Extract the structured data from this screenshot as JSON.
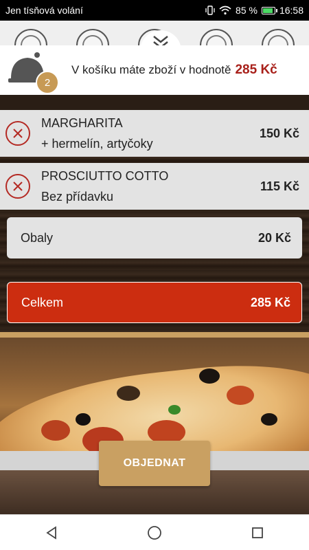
{
  "status_bar": {
    "carrier": "Jen tísňová volání",
    "battery_percent": "85 %",
    "battery_level": 0.85,
    "time": "16:58",
    "icons": [
      "vibrate-icon",
      "wifi-icon",
      "battery-icon"
    ]
  },
  "cart": {
    "item_count": "2",
    "message": "V košíku máte zboží v hodnotě",
    "total": "285 Kč"
  },
  "items": [
    {
      "name": "MARGHARITA",
      "extras": "+ hermelín, artyčoky",
      "price": "150 Kč"
    },
    {
      "name": "PROSCIUTTO COTTO",
      "extras": "Bez přídavku",
      "price": "115 Kč"
    }
  ],
  "packaging": {
    "label": "Obaly",
    "price": "20 Kč"
  },
  "summary": {
    "label": "Celkem",
    "price": "285 Kč"
  },
  "order_button": {
    "label": "OBJEDNAT"
  },
  "colors": {
    "accent": "#c9a062",
    "total_bar": "#cc2d10",
    "price_red": "#a8201a",
    "remove_red": "#b42a24"
  }
}
